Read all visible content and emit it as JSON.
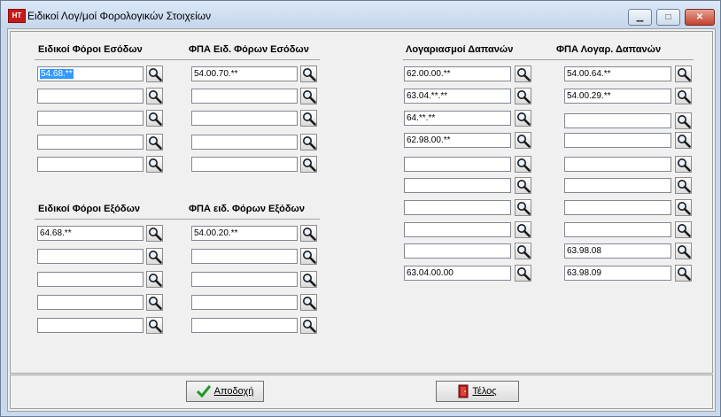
{
  "window": {
    "title": "Ειδικοί Λογ/μοί Φορολογικών Στοιχείων",
    "app_icon_text": "ΗΤ",
    "min_glyph": "▁",
    "max_glyph": "□",
    "close_glyph": "✕"
  },
  "sections": {
    "income_special": {
      "header": "Ειδικοί Φόροι Εσόδων",
      "values": [
        "54.68.**",
        "",
        "",
        "",
        ""
      ]
    },
    "income_vat": {
      "header": "ΦΠΑ Ειδ. Φόρων Εσόδων",
      "values": [
        "54.00.70.**",
        "",
        "",
        "",
        ""
      ]
    },
    "expense_special": {
      "header": "Ειδικοί Φόροι Εξόδων",
      "values": [
        "64.68.**",
        "",
        "",
        "",
        ""
      ]
    },
    "expense_vat": {
      "header": "ΦΠΑ ειδ. Φόρων Εξόδων",
      "values": [
        "54.00.20.**",
        "",
        "",
        "",
        ""
      ]
    },
    "expense_accounts": {
      "header": "Λογαριασμοί Δαπανών",
      "values": [
        "62.00.00.**",
        "63.04.**.**",
        "64.**.**",
        "62.98.00.**",
        "",
        "",
        "",
        "",
        "",
        "63.04.00.00"
      ]
    },
    "expense_accounts_vat": {
      "header": "ΦΠΑ Λογαρ. Δαπανών",
      "values": [
        "54.00.64.**",
        "54.00.29.**",
        "",
        "",
        "",
        "",
        "",
        "",
        "63.98.08",
        "63.98.09"
      ]
    }
  },
  "footer": {
    "ok_label": "Αποδοχή",
    "end_label": "Τέλος"
  }
}
